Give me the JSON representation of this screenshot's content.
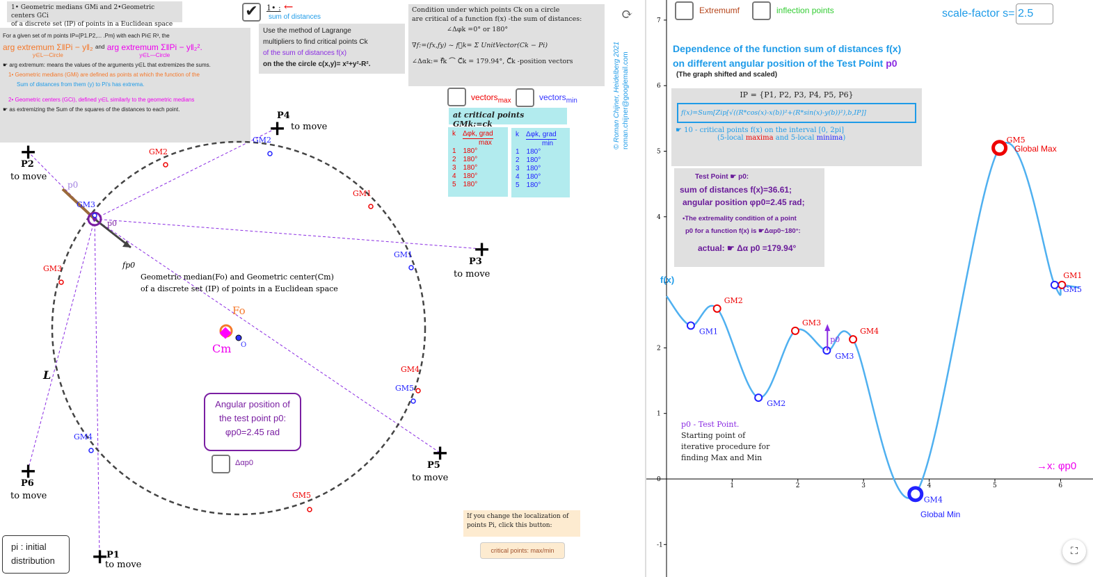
{
  "left": {
    "title1": "1• Geometric medians GMi and 2•Geometric centers GCi",
    "title2": "of a discrete set (IP) of points in a Euclidean space on a circle",
    "def1": "For a given set of m points IP={P1.P2,... .Pm} with each Pi∈ R³, the",
    "def_formula1": "arg extremum Σ‖Pi − y‖₂",
    "def_and": "and",
    "def_formula2": "arg extremum Σ‖Pi − y‖₂².",
    "def_sub": "y∈L—Circle",
    "def2": "☛ arg extremum: means the values of the arguments y∈L that extremizes the sums.",
    "def3a": "1•  Geometric medians (GMi) are defined as points at which the function of the",
    "def3b": "Sum of distances from them (y) to Pi's has extrema.",
    "def4a": "2•  Geometric centers (GCi), defined y∈L similarly to the geometric medians",
    "def4b": "☛ as extremizing the Sum of the squares of the distances to each point.",
    "check1_label": "1• :",
    "check1_sub": "sum of distances",
    "lagrange": [
      "Use the method of  Lagrange",
      "multipliers to find critical points Ck",
      "of the sum of distances f(x)",
      "on the the circle c(x,y)= x²+y²-R²."
    ],
    "cond": [
      "Condition under which points Ck on a circle",
      "are critical of a function f(x) -the sum of distances:",
      "∠Δφk =0° or 180°",
      "∇f:=(fx,fy) ~ f⃗k= Σ UnitVector(Ck − Pi)",
      "∠Δαk:= f⃗k ⌒ C⃗k = 179.94°, C⃗k -position vectors"
    ],
    "vectors_max": "vectors",
    "vectors_max_sub": "max",
    "vectors_min": "vectors",
    "vectors_min_sub": "min",
    "critical_header": "at critical points GMk:=ck",
    "table_max": {
      "k": "k",
      "head": "Δφk, grad",
      "sub": "max",
      "rows": [
        [
          "1",
          "180°"
        ],
        [
          "2",
          "180°"
        ],
        [
          "3",
          "180°"
        ],
        [
          "4",
          "180°"
        ],
        [
          "5",
          "180°"
        ]
      ]
    },
    "table_min": {
      "k": "k",
      "head": "Δφk, grad",
      "sub": "min",
      "rows": [
        [
          "1",
          "180°"
        ],
        [
          "2",
          "180°"
        ],
        [
          "3",
          "180°"
        ],
        [
          "4",
          "180°"
        ],
        [
          "5",
          "180°"
        ]
      ]
    },
    "author": "© Roman Chijner, Heidelberg 2021",
    "email": "roman.chijner@googlemail.com",
    "points": [
      {
        "name": "P1",
        "sub": "to move"
      },
      {
        "name": "P2",
        "sub": "to move"
      },
      {
        "name": "P3",
        "sub": "to move"
      },
      {
        "name": "P4",
        "sub": "to move"
      },
      {
        "name": "P5",
        "sub": "to move"
      },
      {
        "name": "P6",
        "sub": "to move"
      }
    ],
    "median_text1": "Geometric median(Fo) and Geometric center(Cm)",
    "median_text2": "of a discrete set (IP) of  points in a Euclidean space",
    "fo": "Fo",
    "cm": "Cm",
    "o": "O",
    "L": "L",
    "p0": "p0",
    "p0vec": "p0",
    "fp0": "fp0",
    "gm_red": [
      "GM1",
      "GM2",
      "GM3",
      "GM4",
      "GM5"
    ],
    "gm_blue": [
      "GM1",
      "GM2",
      "GM3",
      "GM4",
      "GM5"
    ],
    "angular_box": [
      "Angular position of",
      "the test point p0:",
      "φp0=2.45 rad"
    ],
    "delta_check": "Δαp0",
    "change_note": "If you change the localization of points Pi, click this button:",
    "crit_button": "critical points: max/min",
    "initial_button": "pi : initial distribution"
  },
  "right": {
    "extremum_check": "Extremumf",
    "inflection_check": "inflection points",
    "scale_label": "scale-factor s=",
    "scale_value": "2.5",
    "title1": "Dependence of the function sum of distances f(x)",
    "title2a": "on different angular position of the Test Point ",
    "title2b": "p0",
    "subtitle": "(The graph shifted and scaled)",
    "ip": "IP = {P1, P2, P3, P4, P5, P6}",
    "formula": "f(x)=Sum[Zip[√((R*cos(x)-x(b))²+(R*sin(x)-y(b))²),b,IP]]",
    "crit1": "☛ 10 -  critical points f(x) on the interval [0, 2pi]",
    "crit2a": "(5-local ",
    "crit2b": "maxima",
    "crit2c": " and 5-local ",
    "crit2d": "minima",
    "crit2e": ")",
    "test": [
      "Test Point ☛ p0:",
      "sum of distances f(x)=36.61;",
      "angular position φp0=2.45 rad;",
      "•The extremality condition of a point",
      "p0 for a function f(x) is ☛Δαp0~180°:",
      "actual: ☛ Δα p0 =179.94°"
    ],
    "p0_note": [
      "p0  - Test Point.",
      "Starting point of",
      "iterative procedure for",
      "finding Max and Min"
    ],
    "global_max": "Global Max",
    "global_min": "Global Min",
    "fx_label": "f(x)",
    "x_label": "→x: φp0"
  },
  "chart_data": {
    "type": "line",
    "xlabel": "→x: φp0",
    "ylabel": "f(x)",
    "xlim": [
      -0.25,
      6.5
    ],
    "ylim": [
      -1.4,
      7.3
    ],
    "xticks": [
      1,
      2,
      3,
      4,
      5,
      6
    ],
    "yticks": [
      -1,
      0,
      1,
      2,
      3,
      4,
      5,
      6,
      7
    ],
    "color": "#4fb0f0",
    "points": [
      [
        0,
        2.79
      ],
      [
        0.37,
        2.34
      ],
      [
        0.77,
        2.6
      ],
      [
        1.4,
        1.24
      ],
      [
        1.96,
        2.26
      ],
      [
        2.44,
        1.96
      ],
      [
        2.84,
        2.13
      ],
      [
        3.79,
        -0.23
      ],
      [
        5.07,
        5.05
      ],
      [
        5.91,
        2.96
      ],
      [
        6.02,
        2.96
      ],
      [
        6.28,
        2.92
      ]
    ],
    "maxima": [
      {
        "name": "GM2",
        "x": 0.77,
        "y": 2.6
      },
      {
        "name": "GM3",
        "x": 1.96,
        "y": 2.26
      },
      {
        "name": "GM4",
        "x": 2.84,
        "y": 2.13
      },
      {
        "name": "GM5",
        "x": 5.07,
        "y": 5.05
      },
      {
        "name": "GM1",
        "x": 6.02,
        "y": 2.96
      }
    ],
    "minima": [
      {
        "name": "GM1",
        "x": 0.37,
        "y": 2.34
      },
      {
        "name": "GM2",
        "x": 1.4,
        "y": 1.24
      },
      {
        "name": "GM3",
        "x": 2.44,
        "y": 1.96
      },
      {
        "name": "GM4",
        "x": 3.79,
        "y": -0.23
      },
      {
        "name": "GM5",
        "x": 5.91,
        "y": 2.96
      }
    ],
    "test_point": {
      "name": "p0",
      "x": 2.45,
      "y": 1.96
    }
  }
}
